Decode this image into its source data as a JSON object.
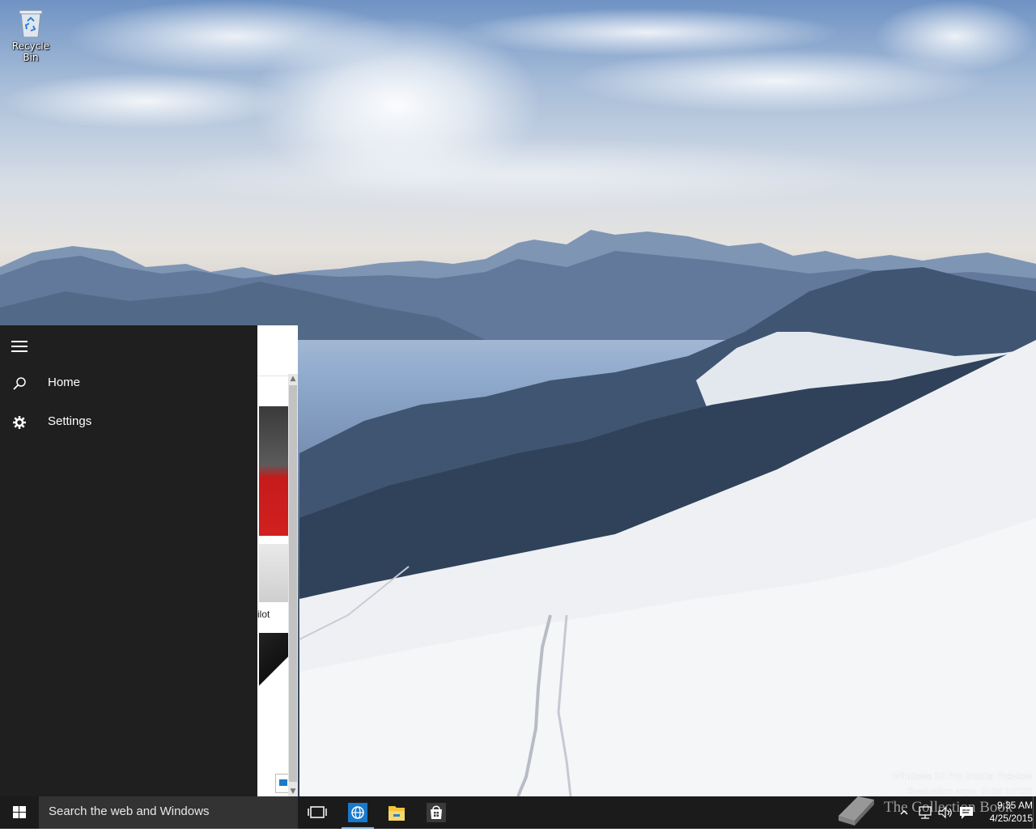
{
  "desktop": {
    "recycle_bin_label": "Recycle Bin"
  },
  "search_pane": {
    "nav": [
      {
        "label": "Home",
        "icon": "search-icon"
      },
      {
        "label": "Settings",
        "icon": "gear-icon"
      }
    ],
    "partial_caption": "ilot"
  },
  "taskbar": {
    "search_placeholder": "Search the web and Windows",
    "pinned": [
      "task-view-icon",
      "internet-explorer-icon",
      "file-explorer-icon",
      "store-icon"
    ],
    "clock_time": "9:35 AM",
    "clock_date": "4/25/2015"
  },
  "watermark": {
    "line1": "Windows 10 Pro Insider Preview",
    "line2": "Evaluation copy. Build 10108"
  },
  "overlay": {
    "text": "The Collection Book"
  },
  "colors": {
    "pane_bg": "#1f1f1f",
    "taskbar_bg": "#1b1b1b",
    "search_bg": "#333333",
    "accent": "#1979ca"
  }
}
